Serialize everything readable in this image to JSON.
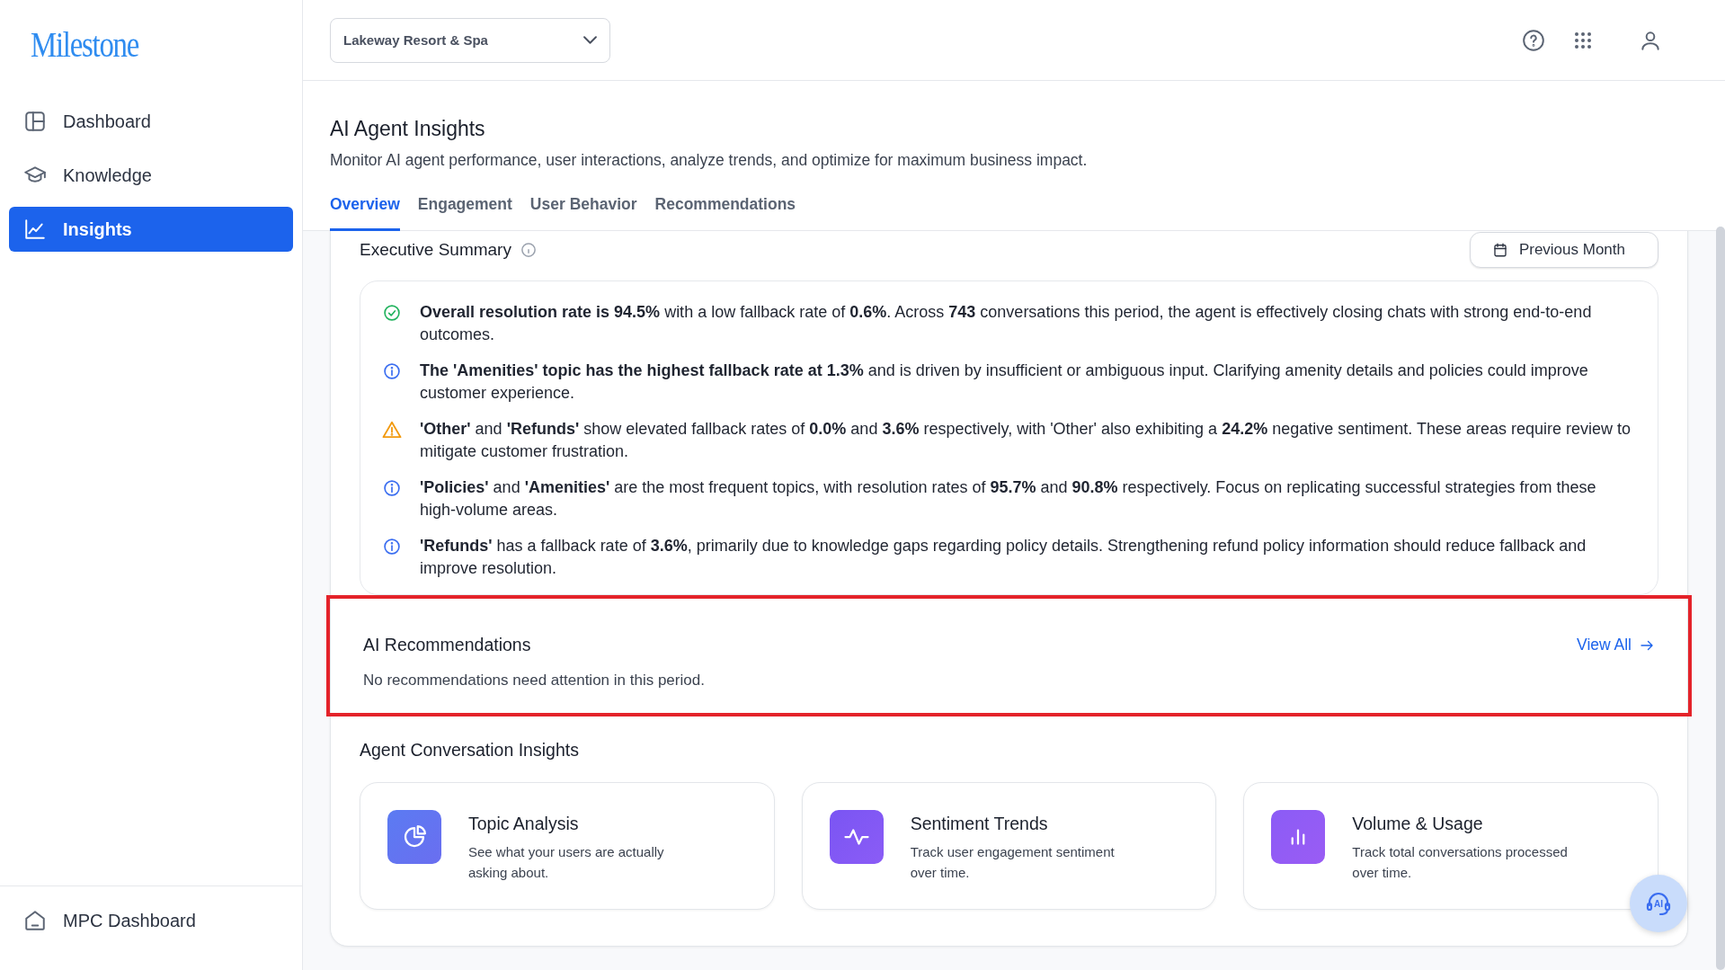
{
  "logo": "Milestone",
  "sidebar": {
    "items": [
      {
        "kind": "dashboard",
        "label": "Dashboard",
        "selected": false
      },
      {
        "kind": "knowledge",
        "label": "Knowledge",
        "selected": false
      },
      {
        "kind": "insights",
        "label": "Insights",
        "selected": true
      }
    ],
    "footer_items": [
      {
        "kind": "home",
        "label": "MPC Dashboard",
        "selected": false
      }
    ]
  },
  "header": {
    "property_select": {
      "value": "Lakeway Resort & Spa"
    }
  },
  "page": {
    "title": "AI Agent Insights",
    "subtitle": "Monitor AI agent performance, user interactions, analyze trends, and optimize for maximum business impact."
  },
  "tabs": [
    {
      "label": "Overview",
      "selected": true
    },
    {
      "label": "Engagement",
      "selected": false
    },
    {
      "label": "User Behavior",
      "selected": false
    },
    {
      "label": "Recommendations",
      "selected": false
    }
  ],
  "executive_summary": {
    "title": "Executive Summary",
    "period_button": "Previous Month",
    "insights": [
      {
        "kind": "success",
        "text": "**Overall resolution rate is 94.5%** with a low fallback rate of **0.6%**. Across **743** conversations this period, the agent is effectively closing chats with strong end-to-end outcomes."
      },
      {
        "kind": "info",
        "text": "**The 'Amenities' topic has the highest fallback rate at 1.3%** and is driven by insufficient or ambiguous input. Clarifying amenity details and policies could improve customer experience."
      },
      {
        "kind": "warning",
        "text": "**'Other'** and **'Refunds'** show elevated fallback rates of **0.0%** and **3.6%** respectively, with 'Other' also exhibiting a **24.2%** negative sentiment. These areas require review to mitigate customer frustration."
      },
      {
        "kind": "info",
        "text": "**'Policies'** and **'Amenities'** are the most frequent topics, with resolution rates of **95.7%** and **90.8%** respectively. Focus on replicating successful strategies from these high-volume areas."
      },
      {
        "kind": "info",
        "text": "**'Refunds'** has a fallback rate of **3.6%**, primarily due to knowledge gaps regarding policy details. Strengthening refund policy information should reduce fallback and improve resolution."
      }
    ]
  },
  "recommendations": {
    "title": "AI Recommendations",
    "link": "View All",
    "empty_message": "No recommendations need attention in this period.",
    "highlighted": true
  },
  "conversation_insights": {
    "title": "Agent Conversation Insights",
    "cards": [
      {
        "kind": "topics",
        "title": "Topic Analysis",
        "description": "See what your users are actually asking about."
      },
      {
        "kind": "sentiment",
        "title": "Sentiment Trends",
        "description": "Track user engagement sentiment over time."
      },
      {
        "kind": "volume",
        "title": "Volume & Usage",
        "description": "Track total conversations processed over time."
      }
    ]
  },
  "assistant_button": {
    "label": "AI"
  }
}
